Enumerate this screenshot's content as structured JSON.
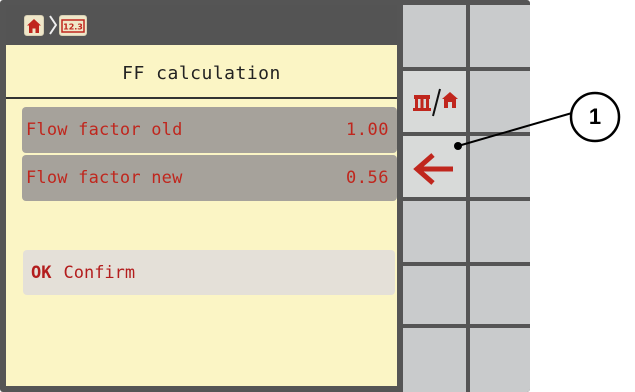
{
  "breadcrumb": {
    "home_icon": "home-icon",
    "separator_icon": "chevron-right-icon",
    "mode_icon": "numeric-keypad-icon",
    "mode_text": "12.3"
  },
  "screen": {
    "title": "FF calculation"
  },
  "rows": [
    {
      "label": "Flow factor old",
      "value": "1.00"
    },
    {
      "label": "Flow factor new",
      "value": "0.56"
    }
  ],
  "confirm": {
    "ok_label": "OK",
    "label": "Confirm"
  },
  "softkeys": {
    "fn_icon": "spreader-home-toggle-icon",
    "back_icon": "back-arrow-icon"
  },
  "callout": {
    "number": "1"
  },
  "colors": {
    "panel_background": "#fbf5c5",
    "row_background": "#a6a29b",
    "text_red": "#c0261d",
    "softkey_gray": "#c9cbcc",
    "frame_gray": "#555555"
  }
}
